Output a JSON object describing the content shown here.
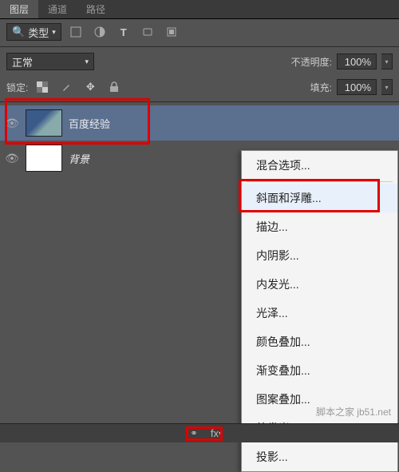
{
  "tabs": {
    "layers": "图层",
    "channels": "通道",
    "paths": "路径"
  },
  "filter": {
    "label": "类型"
  },
  "blend": {
    "mode": "正常",
    "opacity_label": "不透明度:",
    "opacity": "100%"
  },
  "lock": {
    "label": "锁定:",
    "fill_label": "填充:",
    "fill": "100%"
  },
  "layer": {
    "name1": "百度经验",
    "name2": "背景"
  },
  "ctx": {
    "blend_opts": "混合选项...",
    "bevel": "斜面和浮雕...",
    "stroke": "描边...",
    "inner_shadow": "内阴影...",
    "inner_glow": "内发光...",
    "satin": "光泽...",
    "color_overlay": "颜色叠加...",
    "grad_overlay": "渐变叠加...",
    "pattern_overlay": "图案叠加...",
    "outer_glow": "外发光...",
    "drop_shadow": "投影..."
  },
  "watermark": "脚本之家 jb51.net",
  "fx_label": "fx"
}
